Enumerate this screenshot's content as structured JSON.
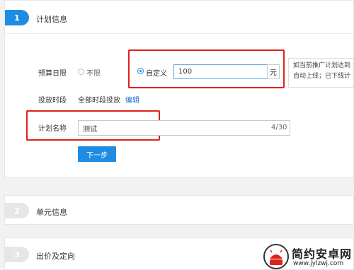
{
  "steps": [
    {
      "number": "1",
      "title": "计划信息"
    },
    {
      "number": "2",
      "title": "单元信息"
    },
    {
      "number": "3",
      "title": "出价及定向"
    }
  ],
  "budget": {
    "label": "预算日限",
    "option_unlimited": "不限",
    "option_custom": "自定义",
    "selected": "自定义",
    "value": "100",
    "unit": "元"
  },
  "schedule": {
    "label": "投放时段",
    "value": "全部时段投放",
    "edit_link": "编辑"
  },
  "plan_name": {
    "label": "计划名称",
    "value": "测试",
    "counter": "4/30"
  },
  "tooltip": {
    "line1": "如当前推广计划达到",
    "line2": "自动上线；已下线计"
  },
  "next_button": "下一步",
  "watermark": {
    "brand": "简约安卓网",
    "url": "www.jylzwj.com"
  },
  "colors": {
    "accent": "#1f8ce3",
    "inactive_badge": "#e6e6e6",
    "highlight_border": "#e0201b"
  }
}
